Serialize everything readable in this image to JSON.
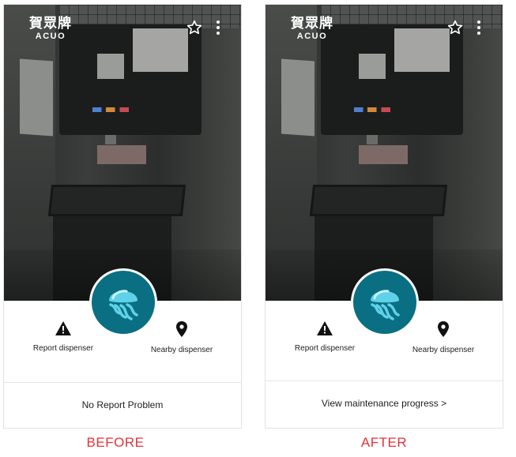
{
  "brand": {
    "name_cn": "賀眾牌",
    "name_en": "ACUO"
  },
  "icons": {
    "favorite": "star-outline-icon",
    "menu": "more-vertical-icon",
    "report": "warning-icon",
    "nearby": "location-pin-icon",
    "mascot": "jellyfish-icon"
  },
  "panels": [
    {
      "report_label": "Report dispenser",
      "nearby_label": "Nearby dispenser",
      "bottom_text": "No Report Problem",
      "caption": "BEFORE"
    },
    {
      "report_label": "Report dispenser",
      "nearby_label": "Nearby dispenser",
      "bottom_text": "View maintenance progress >",
      "caption": "AFTER"
    }
  ],
  "colors": {
    "caption": "#e2333b",
    "mascot_bg": "#0a6f82",
    "mascot_accent": "#5fd1e8"
  }
}
